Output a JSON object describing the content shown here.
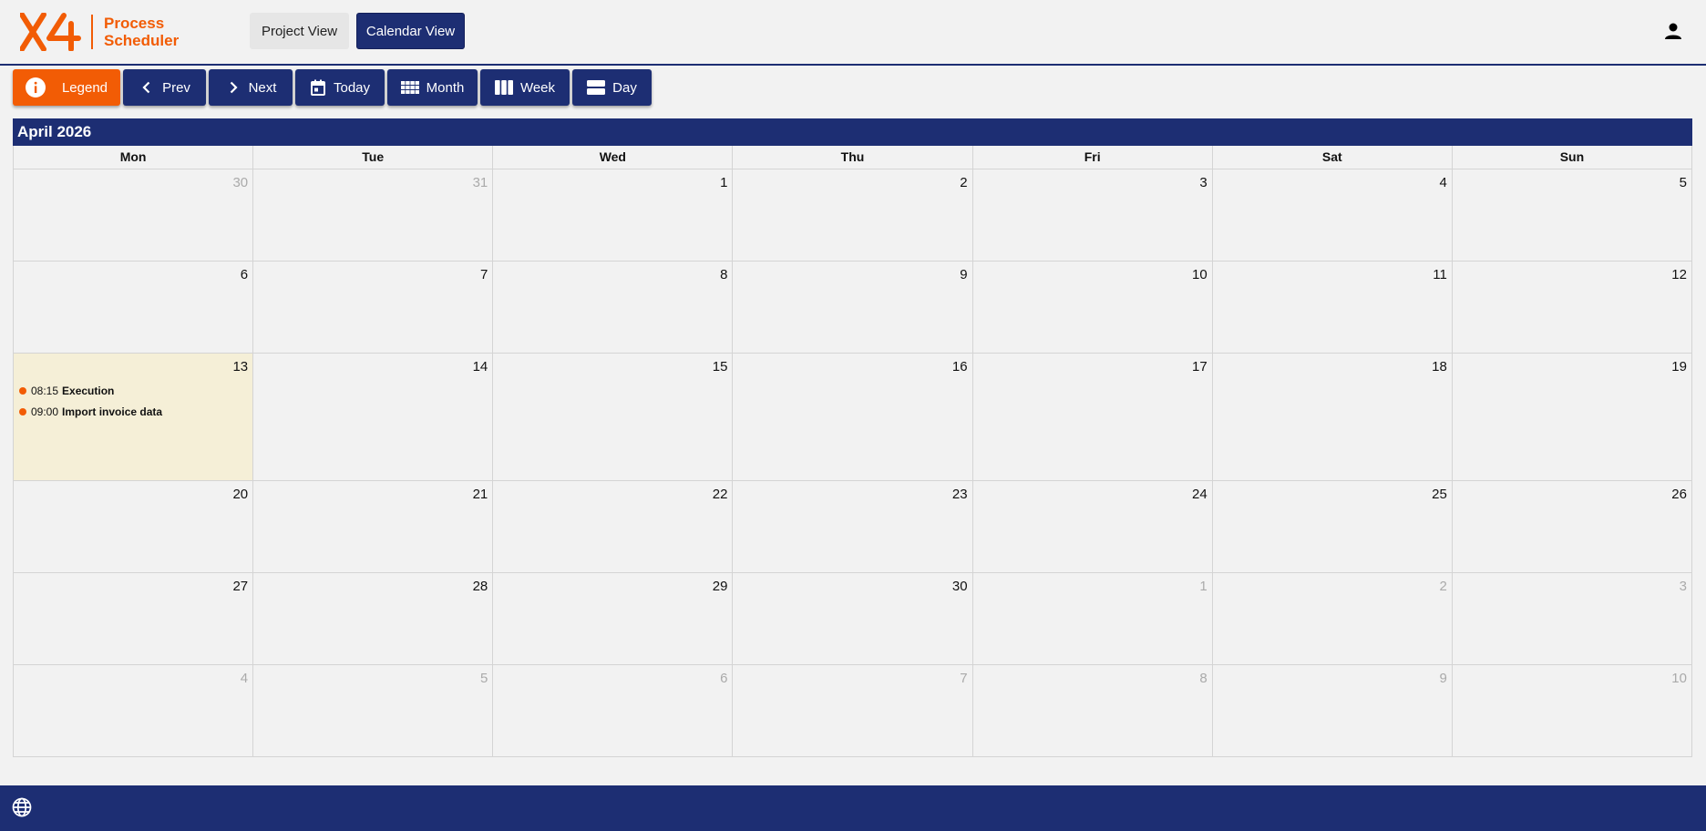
{
  "header": {
    "logo": {
      "mark": "X4",
      "line1": "Process",
      "line2": "Scheduler"
    },
    "views": {
      "project": "Project View",
      "calendar": "Calendar View"
    },
    "user_icon": "person-icon"
  },
  "toolbar": {
    "legend": "Legend",
    "prev": "Prev",
    "next": "Next",
    "today": "Today",
    "month": "Month",
    "week": "Week",
    "day": "Day"
  },
  "calendar": {
    "month_title": "April 2026",
    "weekdays": [
      "Mon",
      "Tue",
      "Wed",
      "Thu",
      "Fri",
      "Sat",
      "Sun"
    ],
    "weeks": [
      [
        {
          "d": "30",
          "other": true
        },
        {
          "d": "31",
          "other": true
        },
        {
          "d": "1"
        },
        {
          "d": "2"
        },
        {
          "d": "3"
        },
        {
          "d": "4"
        },
        {
          "d": "5"
        }
      ],
      [
        {
          "d": "6"
        },
        {
          "d": "7"
        },
        {
          "d": "8"
        },
        {
          "d": "9"
        },
        {
          "d": "10"
        },
        {
          "d": "11"
        },
        {
          "d": "12"
        }
      ],
      [
        {
          "d": "13",
          "today": true,
          "events": [
            {
              "time": "08:15",
              "title": "Execution"
            },
            {
              "time": "09:00",
              "title": "Import invoice data"
            }
          ]
        },
        {
          "d": "14"
        },
        {
          "d": "15"
        },
        {
          "d": "16"
        },
        {
          "d": "17"
        },
        {
          "d": "18"
        },
        {
          "d": "19"
        }
      ],
      [
        {
          "d": "20"
        },
        {
          "d": "21"
        },
        {
          "d": "22"
        },
        {
          "d": "23"
        },
        {
          "d": "24"
        },
        {
          "d": "25"
        },
        {
          "d": "26"
        }
      ],
      [
        {
          "d": "27"
        },
        {
          "d": "28"
        },
        {
          "d": "29"
        },
        {
          "d": "30"
        },
        {
          "d": "1",
          "other": true
        },
        {
          "d": "2",
          "other": true
        },
        {
          "d": "3",
          "other": true
        }
      ],
      [
        {
          "d": "4",
          "other": true
        },
        {
          "d": "5",
          "other": true
        },
        {
          "d": "6",
          "other": true
        },
        {
          "d": "7",
          "other": true
        },
        {
          "d": "8",
          "other": true
        },
        {
          "d": "9",
          "other": true
        },
        {
          "d": "10",
          "other": true
        }
      ]
    ]
  },
  "colors": {
    "brand_orange": "#f25c05",
    "navy": "#1d2e73",
    "today_bg": "#f5efd7"
  },
  "footer": {
    "icon": "globe-icon"
  }
}
